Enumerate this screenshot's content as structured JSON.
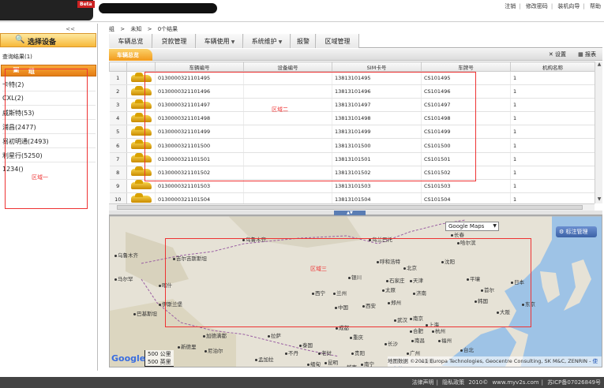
{
  "header": {
    "beta": "Beta",
    "links": [
      "注销",
      "修改密码",
      "装机向导",
      "帮助"
    ]
  },
  "left": {
    "collapse": "<<",
    "select_title": "选择设备",
    "query_result": "查询结果(1)",
    "group_title": "组",
    "groups": [
      "卡特(2)",
      "CXL(2)",
      "威斯特(53)",
      "浦昌(2477)",
      "易初明通(2493)",
      "利星行(5250)",
      "1234()"
    ],
    "region1": "区域一"
  },
  "breadcrumb": [
    "组",
    ">",
    "未知",
    ">",
    "0个结果"
  ],
  "tabs": [
    {
      "label": "车辆总览",
      "dropdown": false
    },
    {
      "label": "贷款管理",
      "dropdown": false
    },
    {
      "label": "车辆使用",
      "dropdown": true
    },
    {
      "label": "系统维护",
      "dropdown": true
    },
    {
      "label": "报警",
      "dropdown": false
    },
    {
      "label": "区域管理",
      "dropdown": false
    }
  ],
  "subbar": {
    "active": "车辆总览",
    "settings": "设置",
    "report": "报表"
  },
  "table": {
    "columns": [
      "",
      "",
      "车辆编号",
      "设备编号",
      "SIM卡号",
      "车牌号",
      "机构名称"
    ],
    "rows": [
      {
        "n": "1",
        "id": "0130000321101495",
        "dev": "",
        "sim": "13813101495",
        "plate": "CS101495",
        "org": "1"
      },
      {
        "n": "2",
        "id": "0130000321101496",
        "dev": "",
        "sim": "13813101496",
        "plate": "CS101496",
        "org": "1"
      },
      {
        "n": "3",
        "id": "0130000321101497",
        "dev": "",
        "sim": "13813101497",
        "plate": "CS101497",
        "org": "1"
      },
      {
        "n": "4",
        "id": "0130000321101498",
        "dev": "",
        "sim": "13813101498",
        "plate": "CS101498",
        "org": "1"
      },
      {
        "n": "5",
        "id": "0130000321101499",
        "dev": "",
        "sim": "13813101499",
        "plate": "CS101499",
        "org": "1"
      },
      {
        "n": "6",
        "id": "0130000321101500",
        "dev": "",
        "sim": "13813101500",
        "plate": "CS101500",
        "org": "1"
      },
      {
        "n": "7",
        "id": "0130000321101501",
        "dev": "",
        "sim": "13813101501",
        "plate": "CS101501",
        "org": "1"
      },
      {
        "n": "8",
        "id": "0130000321101502",
        "dev": "",
        "sim": "13813101502",
        "plate": "CS101502",
        "org": "1"
      },
      {
        "n": "9",
        "id": "0130000321101503",
        "dev": "",
        "sim": "13813101503",
        "plate": "CS101503",
        "org": "1"
      },
      {
        "n": "10",
        "id": "0130000321101504",
        "dev": "",
        "sim": "13813101504",
        "plate": "CS101504",
        "org": "1"
      }
    ],
    "region2": "区域二"
  },
  "map": {
    "type": "Google Maps",
    "marker_btn": "标注管理",
    "region3": "区域三",
    "scale_km": "500 公里",
    "scale_mi": "500 英里",
    "google": "Google",
    "attribution": "地图数据 ©2011 Europa Technologies, Geocentre Consulting, SK M&C, ZENRIN -",
    "terms": "使用条款",
    "cities": [
      "乌鲁木齐",
      "乌鲁木齐",
      "吉尔吉斯斯坦",
      "马尔罕",
      "喀什",
      "巴基斯坦",
      "伊斯兰堡",
      "新德里",
      "尼泊尔",
      "加德满都",
      "乌兰巴托",
      "呼和浩特",
      "北京",
      "天津",
      "石家庄",
      "太原",
      "银川",
      "兰州",
      "西宁",
      "中国",
      "西安",
      "郑州",
      "济南",
      "长春",
      "沈阳",
      "平壤",
      "首尔",
      "韩国",
      "日本",
      "大阪",
      "东京",
      "上海",
      "南京",
      "武汉",
      "长沙",
      "重庆",
      "成都",
      "拉萨",
      "贵阳",
      "昆明",
      "南宁",
      "广州",
      "香港",
      "台北",
      "福州",
      "杭州",
      "合肥",
      "南昌",
      "哈尔滨",
      "不丹",
      "孟加拉",
      "缅甸",
      "越南",
      "老挝",
      "泰国"
    ]
  },
  "footer": {
    "items": [
      "法律声明",
      "隐私政策",
      "2010©",
      "www.myv2s.com",
      "苏ICP备07026849号"
    ]
  },
  "colors": {
    "accent_orange": "#f29a1b",
    "region_red": "#e33"
  }
}
